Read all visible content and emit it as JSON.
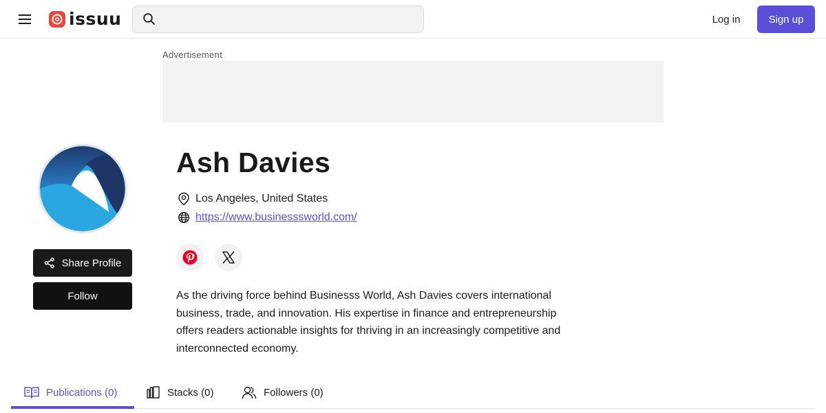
{
  "header": {
    "logo_text": "issuu",
    "search_placeholder": "",
    "login_label": "Log in",
    "signup_label": "Sign up"
  },
  "ad": {
    "label": "Advertisement"
  },
  "profile": {
    "name": "Ash Davies",
    "location": "Los Angeles, United States",
    "website": "https://www.businesssworld.com/",
    "share_label": "Share Profile",
    "follow_label": "Follow",
    "bio": "As the driving force behind Businesss World, Ash Davies covers international business, trade, and innovation. His expertise in finance and entrepreneurship offers readers actionable insights for thriving in an increasingly competitive and interconnected economy."
  },
  "tabs": [
    {
      "label": "Publications (0)",
      "icon": "book-open-icon",
      "active": true
    },
    {
      "label": "Stacks (0)",
      "icon": "stacks-icon",
      "active": false
    },
    {
      "label": "Followers (0)",
      "icon": "users-icon",
      "active": false
    }
  ],
  "colors": {
    "accent": "#5b4fd8",
    "brand_logo": "#e8473c",
    "pinterest": "#e60023",
    "dark_button": "#1a1a1a"
  }
}
